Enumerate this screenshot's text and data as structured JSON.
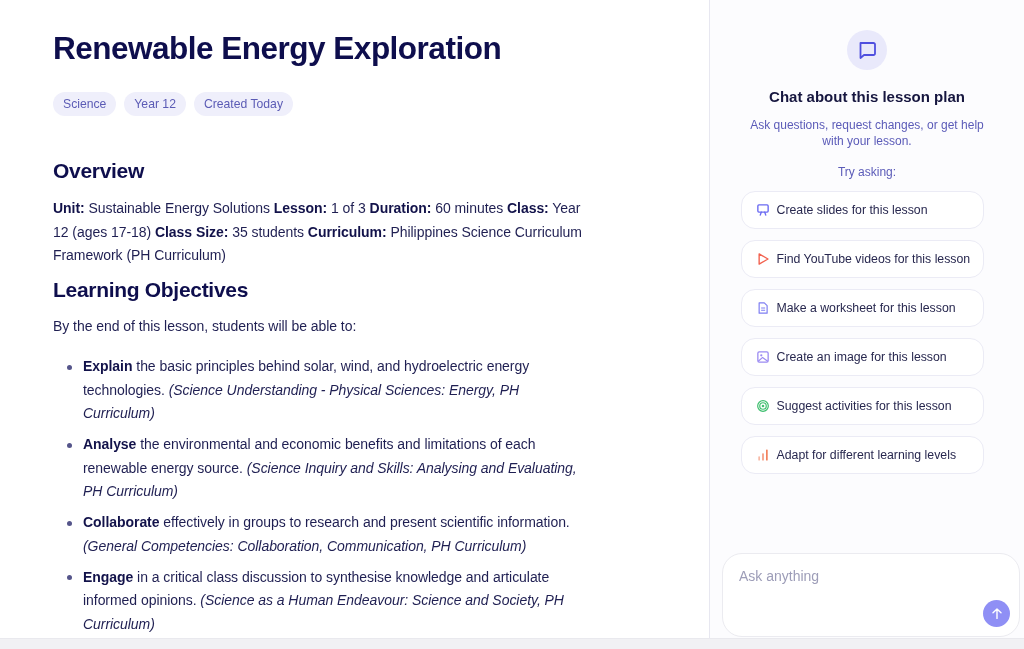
{
  "lesson_plan": {
    "title": "Renewable Energy Exploration",
    "tags": [
      "Science",
      "Year 12",
      "Created Today"
    ],
    "overview": {
      "heading": "Overview",
      "text": "**Unit:** Sustainable Energy Solutions **Lesson:** 1 of 3 **Duration:** 60 minutes **Class:** Year 12 (ages 17-18) **Class Size:** 35 students **Curriculum:** Philippines Science Curriculum Framework (PH Curriculum)"
    },
    "objectives": {
      "heading": "Learning Objectives",
      "intro": "By the end of this lesson, students will be able to:",
      "items": [
        "**Explain** the basic principles behind solar, wind, and hydroelectric energy technologies. *(Science Understanding - Physical Sciences: Energy, PH Curriculum)*",
        "**Analyse** the environmental and economic benefits and limitations of each renewable energy source. *(Science Inquiry and Skills: Analysing and Evaluating, PH Curriculum)*",
        "**Collaborate** effectively in groups to research and present scientific information. *(General Competencies: Collaboration, Communication, PH Curriculum)*",
        "**Engage** in a critical class discussion to synthesise knowledge and articulate informed opinions. *(Science as a Human Endeavour: Science and Society, PH Curriculum)*"
      ]
    }
  },
  "chat_panel": {
    "title": "Chat about this lesson plan",
    "subtitle": "Ask questions, request changes, or get help with your lesson.",
    "prompt_label": "Try asking:",
    "suggestions": [
      {
        "kind": "slides",
        "label": "Create slides for this lesson"
      },
      {
        "kind": "video",
        "label": "Find YouTube videos for this lesson"
      },
      {
        "kind": "worksheet",
        "label": "Make a worksheet for this lesson"
      },
      {
        "kind": "image",
        "label": "Create an image for this lesson"
      },
      {
        "kind": "activities",
        "label": "Suggest activities for this lesson"
      },
      {
        "kind": "levels",
        "label": "Adapt for different learning levels"
      }
    ],
    "input": {
      "placeholder": "Ask anything"
    }
  }
}
